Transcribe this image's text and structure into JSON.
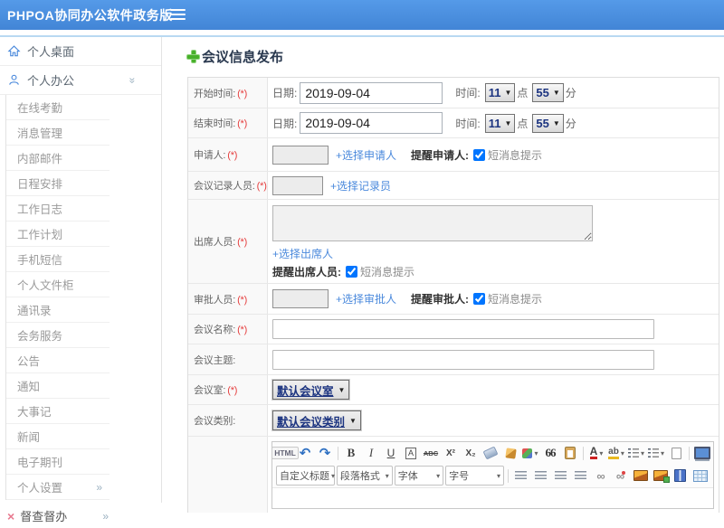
{
  "header": {
    "title": "PHPOA协同办公软件政务版"
  },
  "sidebar": {
    "desktop": {
      "label": "个人桌面"
    },
    "office": {
      "label": "个人办公",
      "chevron": "»"
    },
    "office_items": [
      "在线考勤",
      "消息管理",
      "内部邮件",
      "日程安排",
      "工作日志",
      "工作计划",
      "手机短信",
      "个人文件柜",
      "通讯录",
      "会务服务",
      "公告",
      "通知",
      "大事记",
      "新闻",
      "电子期刊"
    ],
    "settings": {
      "label": "个人设置",
      "chevron": "»"
    },
    "supervise": {
      "label": "督查督办",
      "chevron": "»",
      "icon_glyph": "×"
    }
  },
  "content": {
    "page_title": "会议信息发布",
    "form": {
      "start_time": {
        "label": "开始时间:",
        "required": "(*)",
        "date_label": "日期:",
        "date_value": "2019-09-04",
        "time_label": "时间:",
        "hour": "11",
        "hour_suffix": "点",
        "minute": "55",
        "minute_suffix": "分"
      },
      "end_time": {
        "label": "结束时间:",
        "required": "(*)",
        "date_label": "日期:",
        "date_value": "2019-09-04",
        "time_label": "时间:",
        "hour": "11",
        "hour_suffix": "点",
        "minute": "55",
        "minute_suffix": "分"
      },
      "applicant": {
        "label": "申请人:",
        "required": "(*)",
        "link": "+选择申请人",
        "remind_label": "提醒申请人:",
        "sms_label": "短消息提示"
      },
      "recorder": {
        "label": "会议记录人员:",
        "required": "(*)",
        "link": "+选择记录员"
      },
      "attendees": {
        "label": "出席人员:",
        "required": "(*)",
        "link": "+选择出席人",
        "remind_label": "提醒出席人员:",
        "sms_label": "短消息提示"
      },
      "approver": {
        "label": "审批人员:",
        "required": "(*)",
        "link": "+选择审批人",
        "remind_label": "提醒审批人:",
        "sms_label": "短消息提示"
      },
      "meeting_name": {
        "label": "会议名称:",
        "required": "(*)"
      },
      "meeting_subject": {
        "label": "会议主题:"
      },
      "meeting_room": {
        "label": "会议室:",
        "required": "(*)",
        "value": "默认会议室"
      },
      "meeting_category": {
        "label": "会议类别:",
        "value": "默认会议类别"
      }
    },
    "editor": {
      "row1": [
        {
          "name": "html-source-button",
          "c": "t-html",
          "g": "HTML"
        },
        {
          "name": "undo-icon",
          "c": "t-undo",
          "g": "↶"
        },
        {
          "name": "redo-icon",
          "c": "t-redo",
          "g": "↷"
        },
        {
          "c": "sep"
        },
        {
          "name": "bold-button",
          "c": "t-bold",
          "g": "B"
        },
        {
          "name": "italic-button",
          "c": "t-italic",
          "g": "I"
        },
        {
          "name": "underline-button",
          "c": "t-underline",
          "g": "U"
        },
        {
          "name": "font-box-button",
          "c": "t-abox",
          "g": "A"
        },
        {
          "name": "strikethrough-button",
          "c": "t-strike",
          "g": "ABC"
        },
        {
          "name": "superscript-button",
          "c": "t-sup",
          "g": "X²"
        },
        {
          "name": "subscript-button",
          "c": "t-sub",
          "g": "X₂"
        },
        {
          "name": "eraser-icon",
          "c": "t-eraser"
        },
        {
          "name": "clean-format-icon",
          "c": "t-broom"
        },
        {
          "name": "format-painter-icon",
          "c": "t-painter",
          "dd": true
        },
        {
          "name": "blockquote-button",
          "c": "t-quote",
          "g": "66"
        },
        {
          "name": "paste-icon",
          "c": "t-paste"
        },
        {
          "c": "sep"
        },
        {
          "name": "font-color-button",
          "c": "t-fontcolor",
          "g": "A",
          "dd": true
        },
        {
          "name": "highlight-color-button",
          "c": "t-highlight",
          "g": "ab",
          "dd": true
        },
        {
          "name": "ordered-list-icon",
          "c": "t-ol",
          "dd": true
        },
        {
          "name": "unordered-list-icon",
          "c": "t-ul",
          "dd": true
        },
        {
          "name": "new-page-icon",
          "c": "t-page"
        },
        {
          "c": "sep"
        },
        {
          "name": "fullscreen-icon",
          "c": "t-monitor"
        }
      ],
      "row2": [
        {
          "name": "custom-title-select",
          "c": "tsel w1",
          "g": "自定义标题",
          "dd": true
        },
        {
          "name": "paragraph-format-select",
          "c": "tsel w2",
          "g": "段落格式",
          "dd": true
        },
        {
          "name": "font-family-select",
          "c": "tsel w3",
          "g": "字体",
          "dd": true
        },
        {
          "name": "font-size-select",
          "c": "tsel w4",
          "g": "字号",
          "dd": true
        },
        {
          "c": "sep"
        },
        {
          "name": "align-left-icon",
          "c": "t-al"
        },
        {
          "name": "align-center-icon",
          "c": "t-ac"
        },
        {
          "name": "align-right-icon",
          "c": "t-ar"
        },
        {
          "name": "align-justify-icon",
          "c": "t-aj"
        },
        {
          "name": "link-icon",
          "c": "t-link",
          "g": "∞"
        },
        {
          "name": "unlink-icon",
          "c": "t-unlink",
          "g": "∞"
        },
        {
          "name": "insert-image-icon",
          "c": "t-img"
        },
        {
          "name": "upload-image-icon",
          "c": "t-imgadd"
        },
        {
          "name": "insert-media-icon",
          "c": "t-media"
        },
        {
          "name": "insert-table-icon",
          "c": "t-table"
        }
      ]
    }
  }
}
